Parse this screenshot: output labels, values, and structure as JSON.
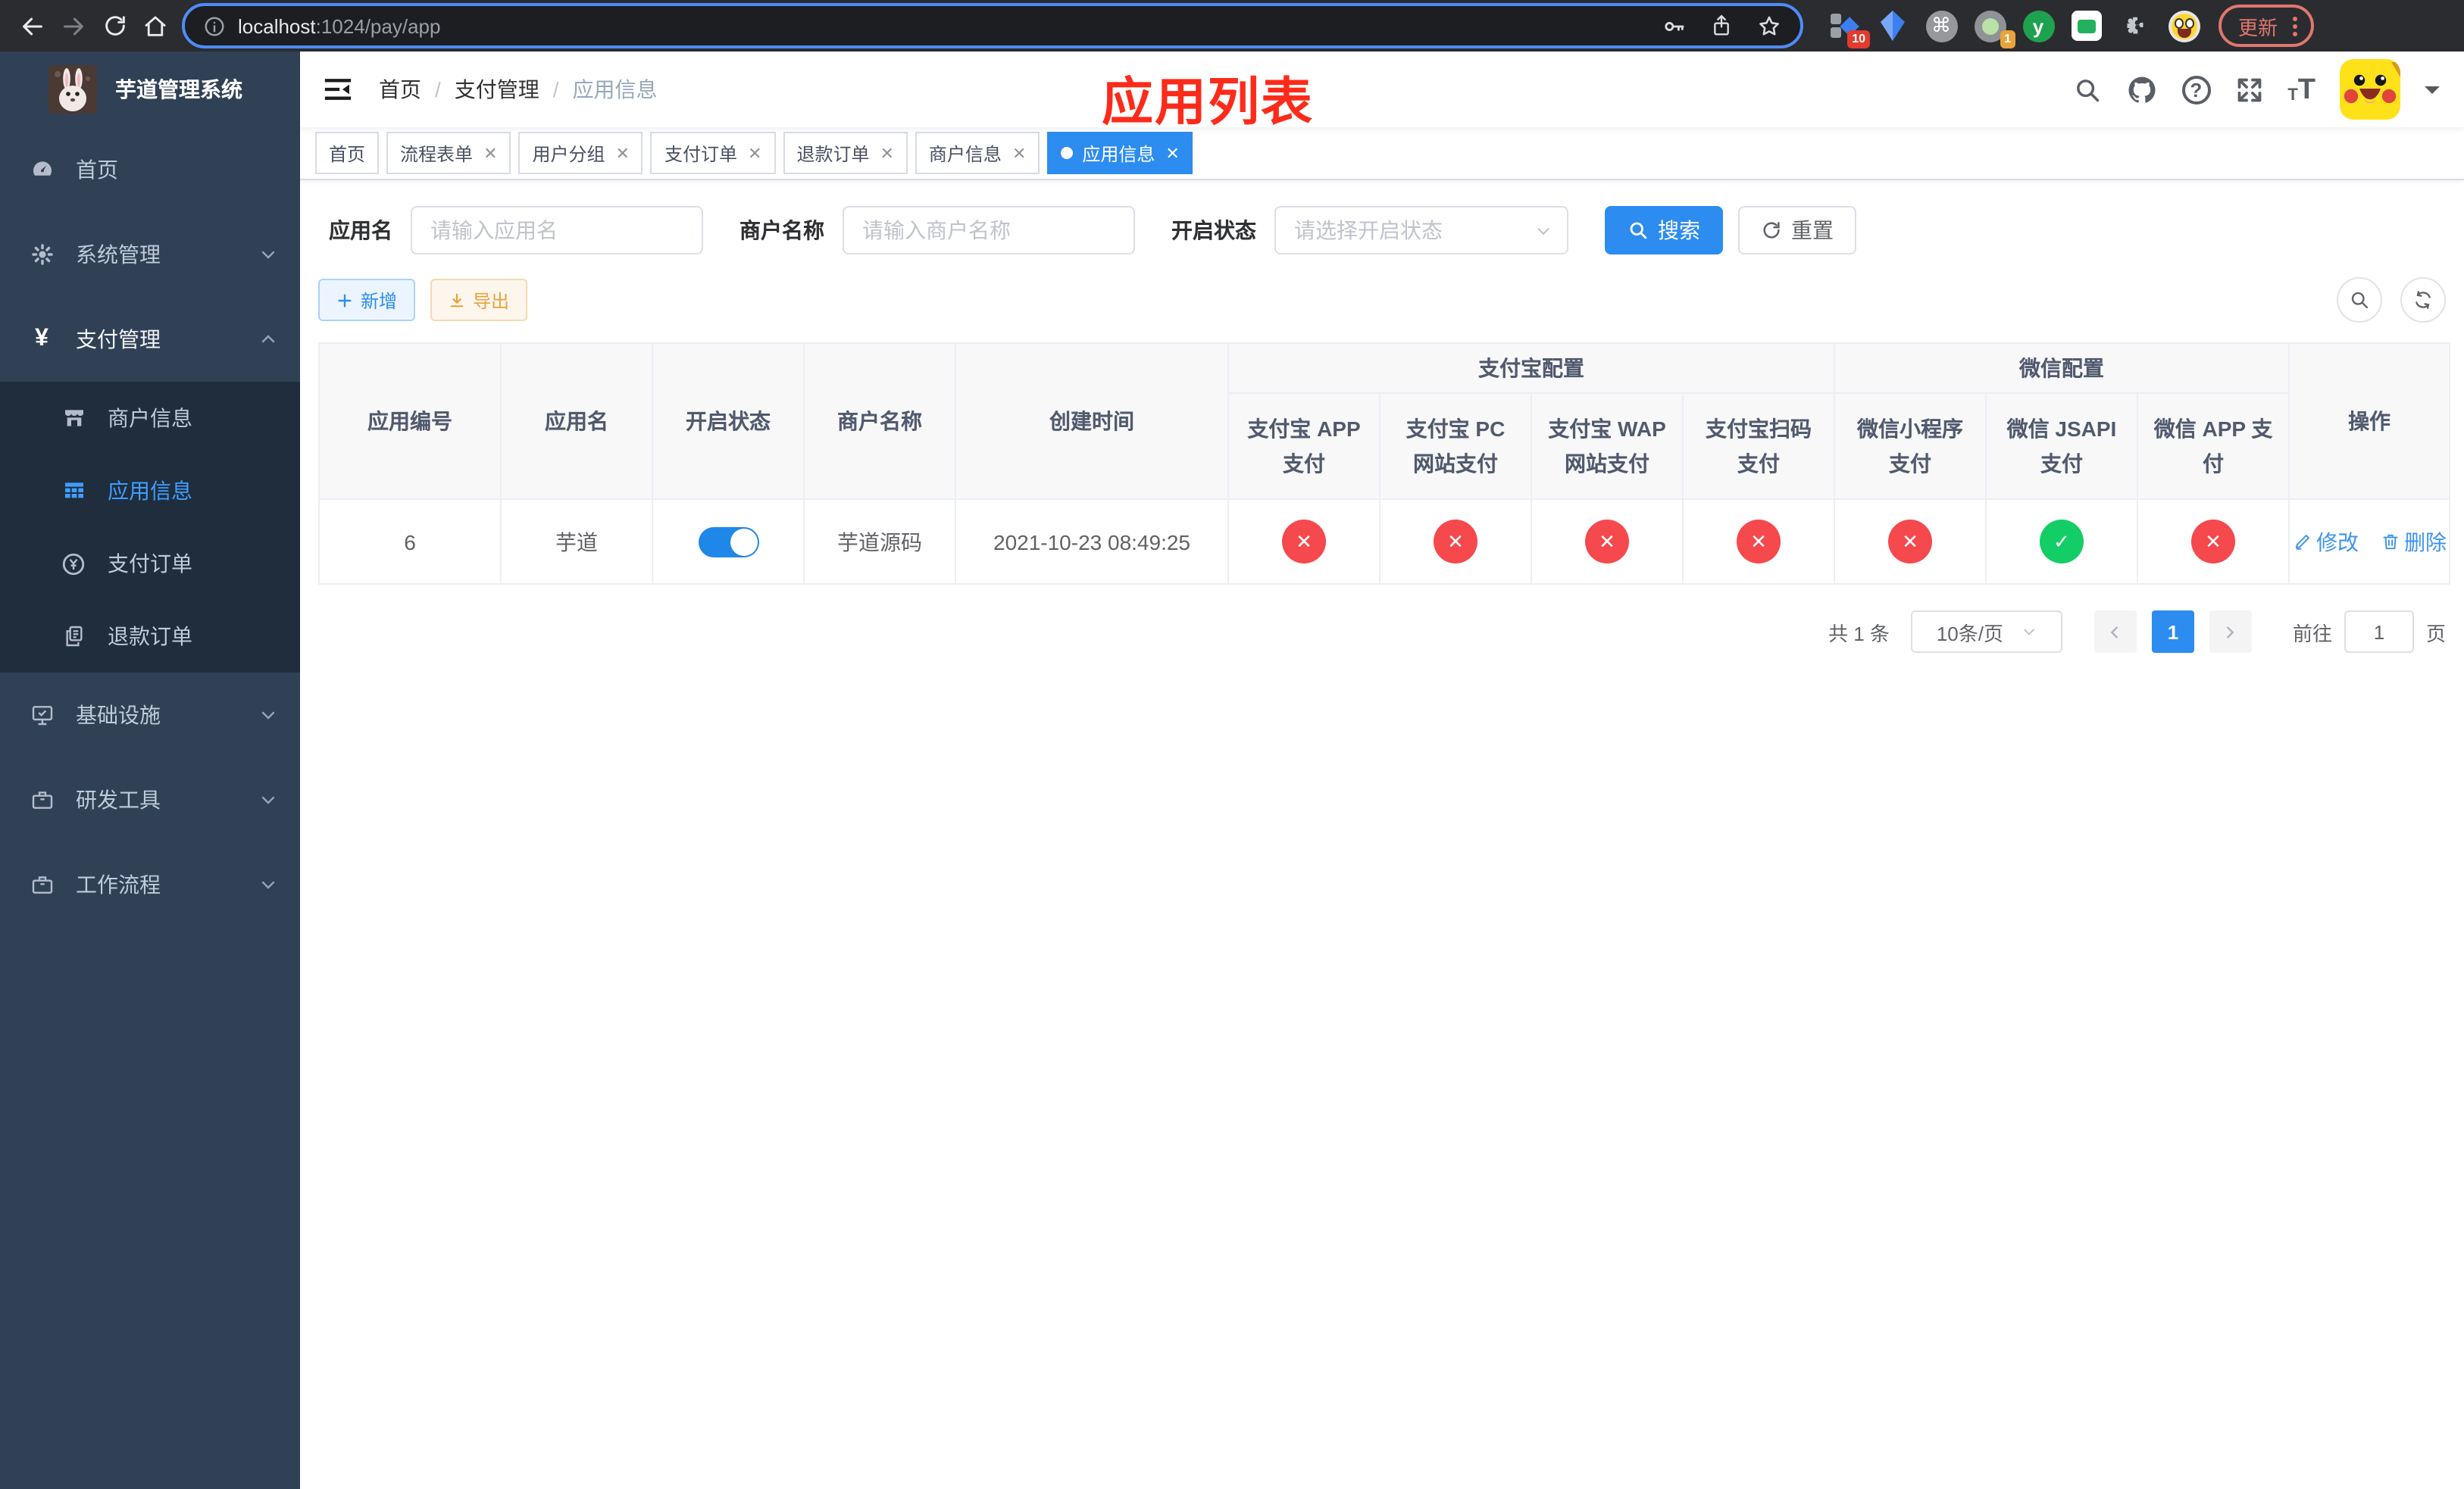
{
  "browser": {
    "url": {
      "host": "localhost",
      "path": ":1024/pay/app"
    },
    "update_label": "更新",
    "ext_badges": {
      "devtools": "10",
      "proxy": "1"
    }
  },
  "sidebar": {
    "title": "芋道管理系统",
    "menu": [
      {
        "label": "首页"
      },
      {
        "label": "系统管理"
      },
      {
        "label": "支付管理",
        "children": [
          {
            "label": "商户信息"
          },
          {
            "label": "应用信息"
          },
          {
            "label": "支付订单"
          },
          {
            "label": "退款订单"
          }
        ]
      },
      {
        "label": "基础设施"
      },
      {
        "label": "研发工具"
      },
      {
        "label": "工作流程"
      }
    ]
  },
  "navbar": {
    "breadcrumb": [
      "首页",
      "支付管理",
      "应用信息"
    ]
  },
  "annotation": "应用列表",
  "tabs": [
    {
      "label": "首页"
    },
    {
      "label": "流程表单"
    },
    {
      "label": "用户分组"
    },
    {
      "label": "支付订单"
    },
    {
      "label": "退款订单"
    },
    {
      "label": "商户信息"
    },
    {
      "label": "应用信息"
    }
  ],
  "filter": {
    "app_name": {
      "label": "应用名",
      "placeholder": "请输入应用名"
    },
    "merchant_name": {
      "label": "商户名称",
      "placeholder": "请输入商户名称"
    },
    "status": {
      "label": "开启状态",
      "placeholder": "请选择开启状态"
    },
    "search_label": "搜索",
    "reset_label": "重置"
  },
  "toolbar": {
    "add_label": "新增",
    "export_label": "导出"
  },
  "table": {
    "columns": [
      "应用编号",
      "应用名",
      "开启状态",
      "商户名称",
      "创建时间"
    ],
    "groups": [
      {
        "label": "支付宝配置",
        "children": [
          "支付宝 APP 支付",
          "支付宝 PC 网站支付",
          "支付宝 WAP 网站支付",
          "支付宝扫码支付"
        ]
      },
      {
        "label": "微信配置",
        "children": [
          "微信小程序支付",
          "微信 JSAPI 支付",
          "微信 APP 支付"
        ]
      }
    ],
    "op_column": "操作",
    "row": {
      "id": "6",
      "name": "芋道",
      "enabled": true,
      "merchant": "芋道源码",
      "created": "2021-10-23 08:49:25",
      "pay_status": [
        false,
        false,
        false,
        false,
        false,
        true,
        false
      ],
      "edit_label": "修改",
      "delete_label": "删除"
    }
  },
  "pagination": {
    "total": "共 1 条",
    "page_size": "10条/页",
    "current_page": "1",
    "goto_label": "前往",
    "goto_value": "1",
    "goto_unit": "页"
  },
  "colors": {
    "accent": "#2d8cf0",
    "sidebar_bg": "#304156",
    "submenu_bg": "#1f2d3d",
    "danger": "#f5494d",
    "success": "#13ce66",
    "annotation_red": "#fc2b1a",
    "warning": "#e6a23c"
  }
}
